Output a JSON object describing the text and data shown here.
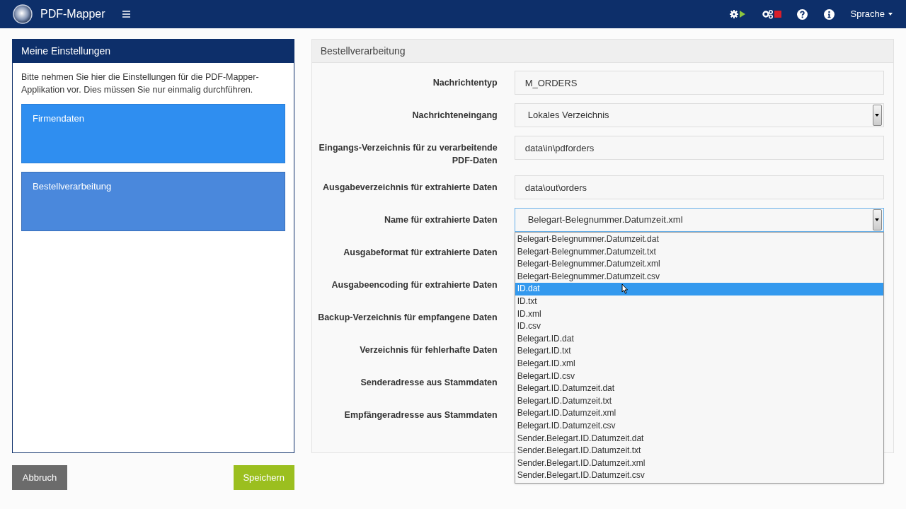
{
  "header": {
    "app_name": "PDF-Mapper",
    "language_menu": "Sprache"
  },
  "sidebar": {
    "title": "Meine Einstellungen",
    "intro": "Bitte nehmen Sie hier die Einstellungen für die PDF-Mapper-Applikation vor. Dies müssen Sie nur einmalig durchführen.",
    "items": [
      {
        "label": "Firmendaten",
        "selected": false
      },
      {
        "label": "Bestellverarbeitung",
        "selected": true
      }
    ]
  },
  "buttons": {
    "cancel": "Abbruch",
    "save": "Speichern"
  },
  "form": {
    "title": "Bestellverarbeitung",
    "rows": [
      {
        "label": "Nachrichtentyp",
        "field": {
          "kind": "text",
          "value": "M_ORDERS"
        }
      },
      {
        "label": "Nachrichteneingang",
        "field": {
          "kind": "select",
          "value": "Lokales Verzeichnis",
          "open": false
        }
      },
      {
        "label": "Eingangs-Verzeichnis für zu verarbeitende PDF-Daten",
        "field": {
          "kind": "text",
          "value": "data\\in\\pdforders"
        }
      },
      {
        "label": "Ausgabeverzeichnis für extrahierte Daten",
        "field": {
          "kind": "text",
          "value": "data\\out\\orders"
        }
      },
      {
        "label": "Name für extrahierte Daten",
        "field": {
          "kind": "select",
          "value": "Belegart-Belegnummer.Datumzeit.xml",
          "open": true,
          "options": [
            {
              "label": "Belegart-Belegnummer.Datumzeit.dat",
              "highlighted": false
            },
            {
              "label": "Belegart-Belegnummer.Datumzeit.txt",
              "highlighted": false
            },
            {
              "label": "Belegart-Belegnummer.Datumzeit.xml",
              "highlighted": false
            },
            {
              "label": "Belegart-Belegnummer.Datumzeit.csv",
              "highlighted": false
            },
            {
              "label": "ID.dat",
              "highlighted": true
            },
            {
              "label": "ID.txt",
              "highlighted": false
            },
            {
              "label": "ID.xml",
              "highlighted": false
            },
            {
              "label": "ID.csv",
              "highlighted": false
            },
            {
              "label": "Belegart.ID.dat",
              "highlighted": false
            },
            {
              "label": "Belegart.ID.txt",
              "highlighted": false
            },
            {
              "label": "Belegart.ID.xml",
              "highlighted": false
            },
            {
              "label": "Belegart.ID.csv",
              "highlighted": false
            },
            {
              "label": "Belegart.ID.Datumzeit.dat",
              "highlighted": false
            },
            {
              "label": "Belegart.ID.Datumzeit.txt",
              "highlighted": false
            },
            {
              "label": "Belegart.ID.Datumzeit.xml",
              "highlighted": false
            },
            {
              "label": "Belegart.ID.Datumzeit.csv",
              "highlighted": false
            },
            {
              "label": "Sender.Belegart.ID.Datumzeit.dat",
              "highlighted": false
            },
            {
              "label": "Sender.Belegart.ID.Datumzeit.txt",
              "highlighted": false
            },
            {
              "label": "Sender.Belegart.ID.Datumzeit.xml",
              "highlighted": false
            },
            {
              "label": "Sender.Belegart.ID.Datumzeit.csv",
              "highlighted": false
            }
          ]
        }
      },
      {
        "label": "Ausgabeformat für extrahierte Daten"
      },
      {
        "label": "Ausgabeencoding für extrahierte Daten"
      },
      {
        "label": "Backup-Verzeichnis für empfangene Daten"
      },
      {
        "label": "Verzeichnis für fehlerhafte Daten"
      },
      {
        "label": "Senderadresse aus Stammdaten"
      },
      {
        "label": "Empfängeradresse aus Stammdaten"
      }
    ]
  }
}
